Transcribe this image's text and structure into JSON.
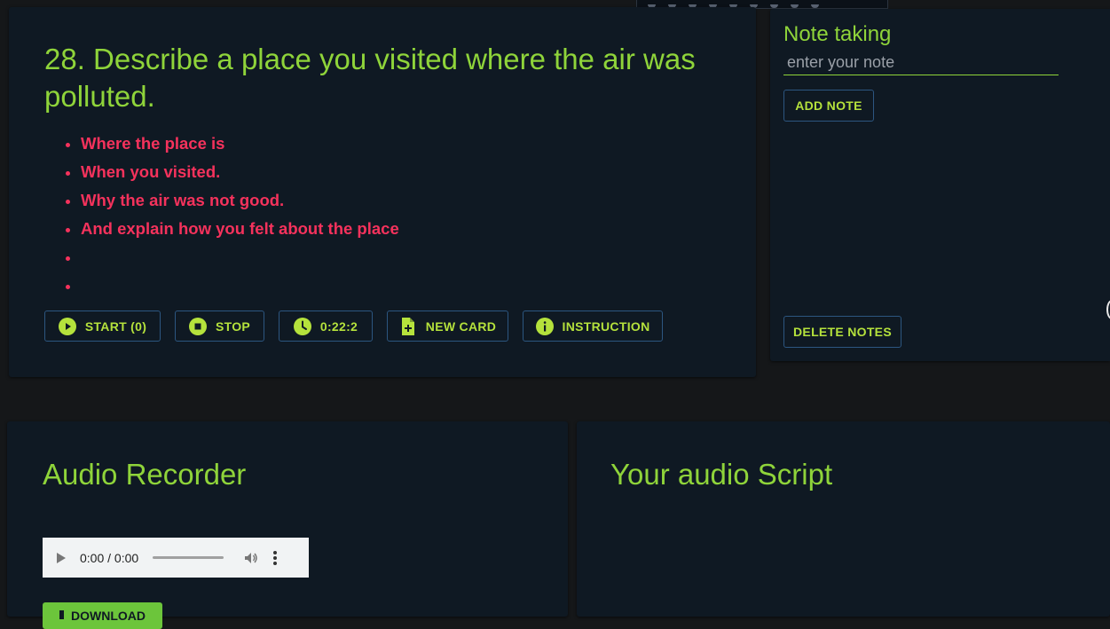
{
  "question": {
    "title": "28. Describe a place you visited where the air was polluted.",
    "cues": [
      "Where the place is",
      "When you visited.",
      "Why the air was not good.",
      "And explain how you felt about the place",
      "",
      ""
    ]
  },
  "controls": {
    "start_label": "START (0)",
    "stop_label": "STOP",
    "timer_value": "0:22:2",
    "new_card_label": "NEW CARD",
    "instruction_label": "INSTRUCTION"
  },
  "notes": {
    "title": "Note taking",
    "input_value": "",
    "input_placeholder": "enter your note",
    "add_label": "ADD NOTE",
    "delete_label": "DELETE NOTES"
  },
  "recorder": {
    "title": "Audio Recorder",
    "player_time": "0:00 / 0:00",
    "download_label": "DOWNLOAD"
  },
  "script": {
    "title": "Your audio Script"
  },
  "icons": {
    "start": "play-circle-icon",
    "stop": "stop-circle-icon",
    "timer": "clock-icon",
    "new_card": "file-plus-icon",
    "instruction": "info-circle-icon",
    "download": "download-icon"
  },
  "colors": {
    "accent_green": "#8fd43a",
    "icon_green": "#b5e23c",
    "cue_red": "#f5325c",
    "card_bg": "#0f1923",
    "page_bg": "#151719",
    "button_border": "#2c5680",
    "download_bg": "#6cc53b"
  }
}
